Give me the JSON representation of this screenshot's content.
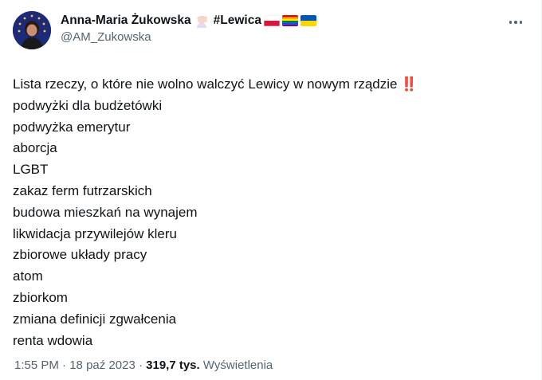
{
  "author": {
    "name": "Anna-Maria Żukowska",
    "hashtag": "#Lewica",
    "handle": "@AM_Zukowska",
    "name_emoji": "woman-raising-hand-emoji",
    "flags": [
      "poland-flag-icon",
      "rainbow-flag-icon",
      "ukraine-flag-icon"
    ]
  },
  "tweet": {
    "headline": "Lista rzeczy, o które nie wolno walczyć Lewicy w nowym rządzie",
    "headline_emoji": "‼️",
    "items": [
      "podwyżki dla budżetówki",
      "podwyżka emerytur",
      "aborcja",
      "LGBT",
      "zakaz ferm futrzarskich",
      "budowa mieszkań na wynajem",
      "likwidacja przywilejów kleru",
      "zbiorowe układy pracy",
      "atom",
      "zbiorkom",
      "zmiana definicji zgwałcenia",
      "renta wdowia"
    ]
  },
  "meta": {
    "time": "1:55 PM",
    "separator": "·",
    "date": "18 paź 2023",
    "views_count": "319,7 tys.",
    "views_label": "Wyświetlenia"
  },
  "colors": {
    "text": "#0f1419",
    "secondary": "#536471",
    "accent_red": "#d62828"
  }
}
